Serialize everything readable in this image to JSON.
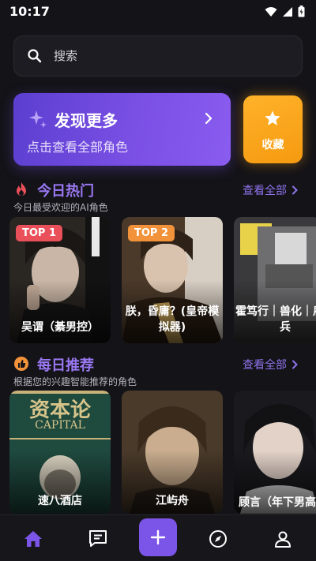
{
  "status": {
    "time": "10:17"
  },
  "search": {
    "placeholder": "搜索"
  },
  "discover": {
    "title": "发现更多",
    "subtitle": "点击查看全部角色"
  },
  "favorites": {
    "label": "收藏"
  },
  "today_hot": {
    "title": "今日热门",
    "subtitle": "今日最受欢迎的AI角色",
    "view_all": "查看全部",
    "cards": [
      {
        "badge": "TOP 1",
        "name": "吴谓（綦男控）"
      },
      {
        "badge": "TOP 2",
        "name": "朕，昏庸？(皇帝模拟器)"
      },
      {
        "badge": "",
        "name": "霍笃行｜兽化｜雇佣兵"
      }
    ]
  },
  "daily_recommend": {
    "title": "每日推荐",
    "subtitle": "根据您的兴趣智能推荐的角色",
    "view_all": "查看全部",
    "cards": [
      {
        "name": "速八酒店",
        "cover_text": "资本论",
        "cover_sub": "CAPITAL"
      },
      {
        "name": "江屿舟"
      },
      {
        "name": "顾言（年下男高）"
      }
    ]
  },
  "colors": {
    "accent": "#7b55e8",
    "section_title": "#9a78f3",
    "top1_badge": "#e9505a",
    "top2_badge": "#f2923a",
    "favorites": "#ffb22a"
  }
}
